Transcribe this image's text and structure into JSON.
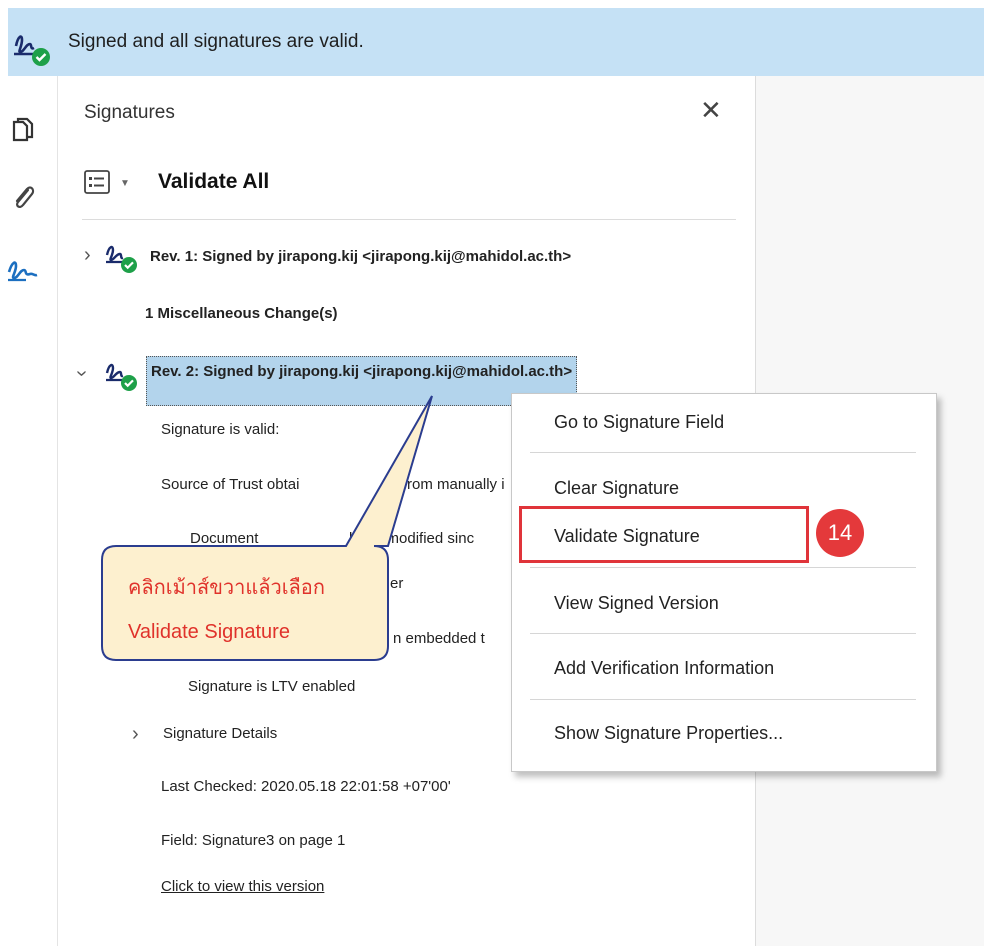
{
  "banner": {
    "text": "Signed and all signatures are valid."
  },
  "left_toolbar": {
    "icons": [
      "pages-icon",
      "attachment-icon",
      "signature-icon"
    ]
  },
  "panel": {
    "title": "Signatures",
    "close_label": "✕",
    "validate_all_label": "Validate All",
    "rev1": {
      "label": "Rev. 1: Signed by jirapong.kij <jirapong.kij@mahidol.ac.th>",
      "change": "1 Miscellaneous Change(s)"
    },
    "rev2": {
      "label": "Rev. 2: Signed by jirapong.kij <jirapong.kij@mahidol.ac.th>",
      "details": [
        "Signature is valid:",
        "Source of Trust obtai",
        "rom manually i",
        "Document",
        "been modified sinc",
        "er",
        "n embedded t",
        "Signature is LTV enabled"
      ],
      "signature_details": "Signature Details",
      "last_checked": "Last Checked: 2020.05.18 22:01:58 +07'00'",
      "field": "Field: Signature3 on page 1",
      "view_version": "Click to view this version"
    }
  },
  "callout": {
    "line1": "คลิกเม้าส์ขวาแล้วเลือก",
    "line2": "Validate Signature"
  },
  "context_menu": {
    "items": [
      "Go to Signature Field",
      "Clear Signature",
      "Validate Signature",
      "View Signed Version",
      "Add Verification Information",
      "Show Signature Properties..."
    ]
  },
  "step_badge": "14",
  "colors": {
    "banner": "#c5e1f5",
    "selection": "#b3d4ec",
    "callout_fill": "#fdf0cf",
    "callout_border": "#2b3d8f",
    "accent_red": "#e0343a",
    "valid_green": "#1ea049"
  }
}
